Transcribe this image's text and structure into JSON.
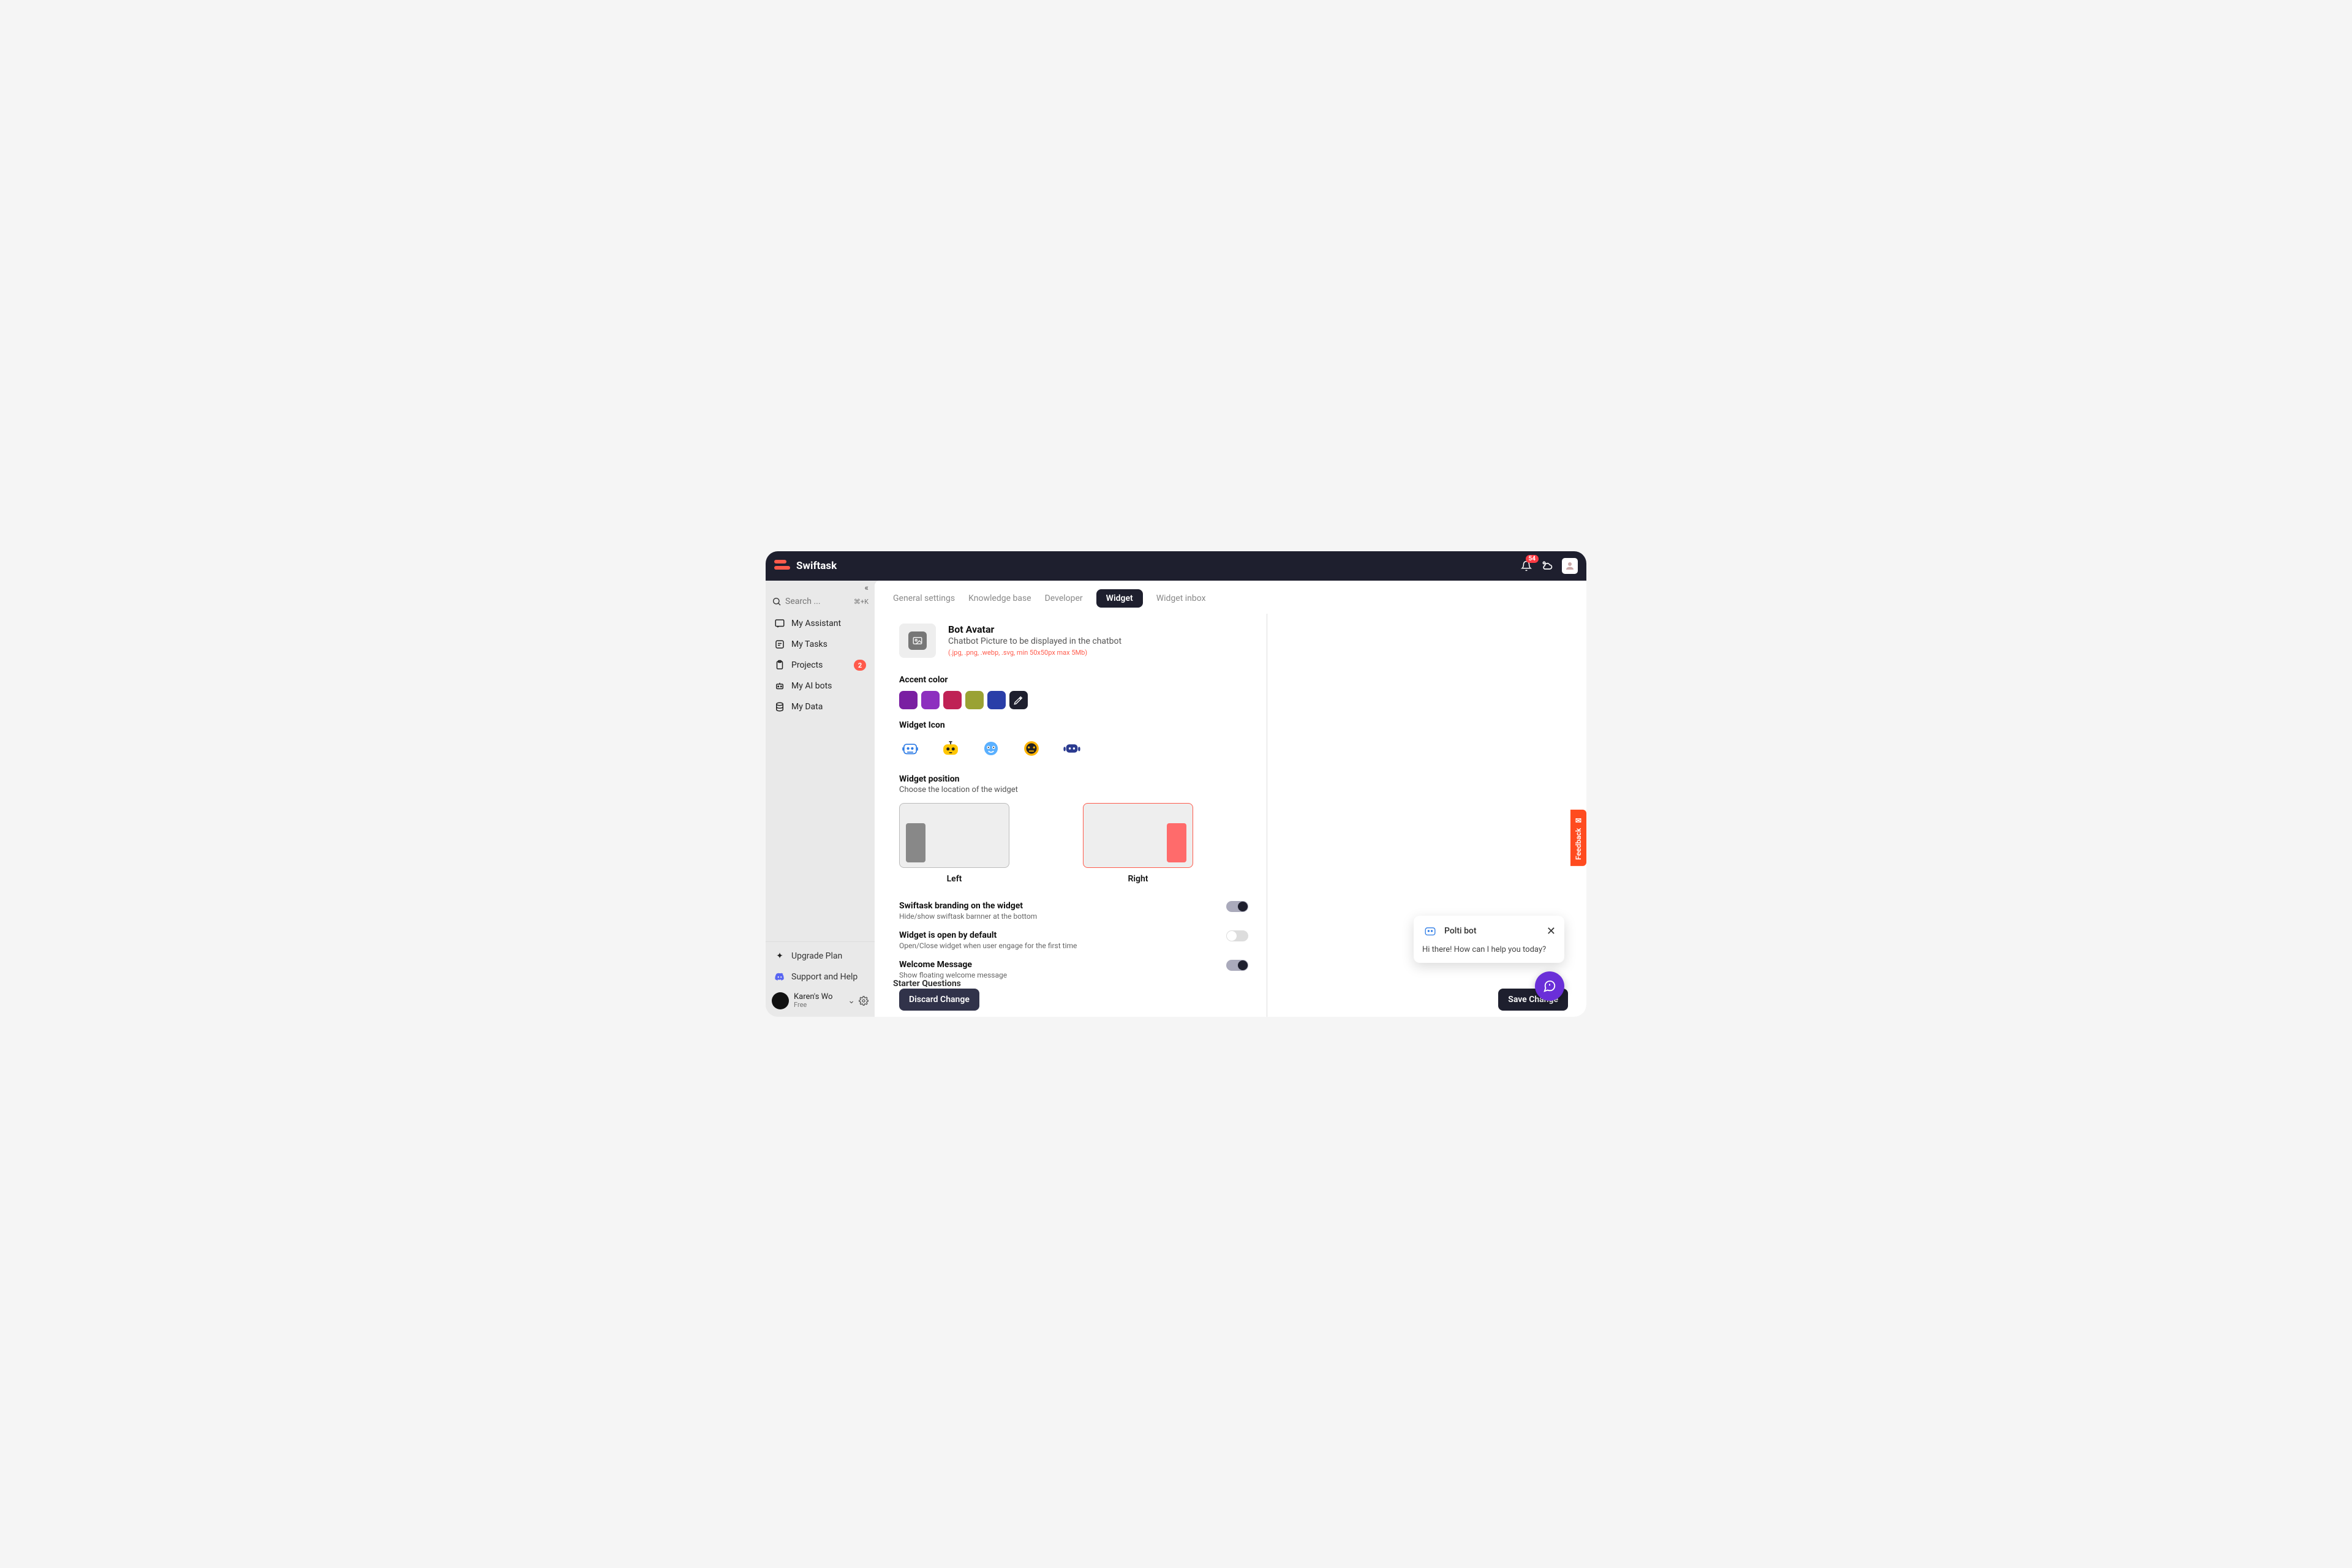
{
  "app": {
    "name": "Swiftask",
    "notification_count": "54"
  },
  "sidebar": {
    "search_placeholder": "Search ...",
    "search_shortcut": "⌘+K",
    "items": [
      {
        "label": "My Assistant"
      },
      {
        "label": "My Tasks"
      },
      {
        "label": "Projects",
        "badge": "2"
      },
      {
        "label": "My AI bots"
      },
      {
        "label": "My Data"
      }
    ],
    "upgrade_label": "Upgrade Plan",
    "support_label": "Support and Help",
    "workspace": {
      "name": "Karen's Wo",
      "plan": "Free"
    }
  },
  "tabs": [
    {
      "label": "General settings"
    },
    {
      "label": "Knowledge base"
    },
    {
      "label": "Developer"
    },
    {
      "label": "Widget",
      "active": true
    },
    {
      "label": "Widget inbox"
    }
  ],
  "settings": {
    "bot_avatar": {
      "title": "Bot Avatar",
      "subtitle": "Chatbot Picture to be displayed in the chatbot",
      "formats": "(.jpg, .png, .webp, .svg, min 50x50px max 5Mb)"
    },
    "accent_label": "Accent color",
    "accent_colors": [
      "#7a1fa2",
      "#8d2fbf",
      "#bf2255",
      "#9aa233",
      "#2a3ea8"
    ],
    "widget_icon_label": "Widget Icon",
    "position": {
      "title": "Widget position",
      "subtitle": "Choose the location of the widget",
      "left_label": "Left",
      "right_label": "Right"
    },
    "toggles": {
      "branding": {
        "title": "Swiftask branding on the widget",
        "sub": "Hide/show swiftask barnner at the bottom"
      },
      "open_default": {
        "title": "Widget is open by default",
        "sub": "Open/Close widget when user engage for the first time"
      },
      "welcome": {
        "title": "Welcome Message",
        "sub": "Show floating welcome message"
      },
      "starter": {
        "title": "Starter Questions"
      }
    },
    "discard_label": "Discard Change",
    "save_label": "Save Change"
  },
  "chat": {
    "title": "Polti bot",
    "message": "Hi there! How can I help you today?"
  },
  "feedback_label": "Feedback"
}
